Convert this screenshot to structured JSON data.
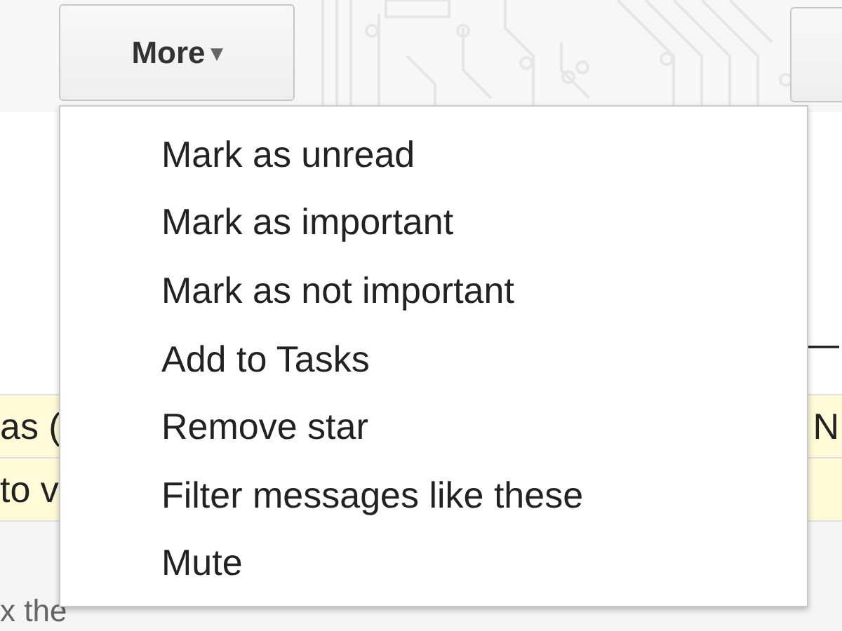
{
  "toolbar": {
    "more_button": {
      "label": "More",
      "caret": "▾"
    }
  },
  "menu": {
    "items": [
      {
        "label": "Mark as unread"
      },
      {
        "label": "Mark as important"
      },
      {
        "label": "Mark as not important"
      },
      {
        "label": "Add to Tasks"
      },
      {
        "label": "Remove star"
      },
      {
        "label": "Filter messages like these"
      },
      {
        "label": "Mute"
      }
    ]
  },
  "messages": [
    {
      "kind": "plain",
      "right": "—"
    },
    {
      "kind": "highlighted",
      "left": "as (",
      "right": "N"
    },
    {
      "kind": "highlighted",
      "left": "to v"
    },
    {
      "kind": "plain",
      "left": "x the"
    }
  ]
}
